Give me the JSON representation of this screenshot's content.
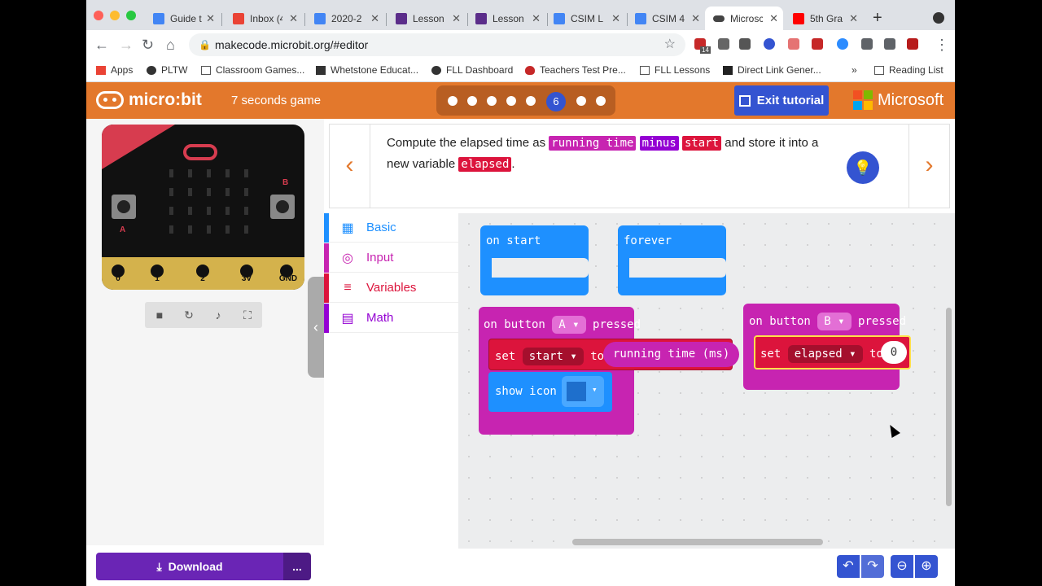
{
  "browser": {
    "tabs": [
      {
        "title": "Guide t",
        "color": "#4285f4"
      },
      {
        "title": "Inbox (4",
        "color": "#ea4335"
      },
      {
        "title": "2020-2",
        "color": "#4285f4"
      },
      {
        "title": "Lesson",
        "color": "#5b2d8a"
      },
      {
        "title": "Lesson",
        "color": "#5b2d8a"
      },
      {
        "title": "CSIM Li",
        "color": "#4285f4"
      },
      {
        "title": "CSIM 4",
        "color": "#4285f4"
      },
      {
        "title": "Microsc",
        "color": "#444444"
      },
      {
        "title": "5th Gra",
        "color": "#ff0000"
      }
    ],
    "new_tab": "+",
    "url": "makecode.microbit.org/#editor",
    "extension_badge": "14",
    "bookmarks": [
      {
        "label": "Apps"
      },
      {
        "label": "PLTW"
      },
      {
        "label": "Classroom Games..."
      },
      {
        "label": "Whetstone Educat..."
      },
      {
        "label": "FLL Dashboard"
      },
      {
        "label": "Teachers Test Pre..."
      },
      {
        "label": "FLL Lessons"
      },
      {
        "label": "Direct Link Gener..."
      }
    ],
    "bookmark_overflow": "»",
    "reading_list": "Reading List"
  },
  "header": {
    "logo_text": "micro:bit",
    "project_title": "7 seconds game",
    "current_step": "6",
    "exit_label": "Exit tutorial",
    "brand": "Microsoft",
    "brand_colors": [
      "#f25022",
      "#7fba00",
      "#00a4ef",
      "#ffb900"
    ],
    "accent": "#e3782c"
  },
  "simulator": {
    "button_a": "A",
    "button_b": "B",
    "pins": [
      "0",
      "1",
      "2",
      "3V",
      "GND"
    ]
  },
  "tutorial": {
    "text_1": "Compute the elapsed time as",
    "code_1": "running time",
    "code_2": "minus",
    "code_3": "start",
    "text_2": "and store it into a new variable",
    "code_4": "elapsed",
    "text_3": "."
  },
  "toolbox": {
    "categories": [
      {
        "label": "Basic",
        "color": "#1e90ff"
      },
      {
        "label": "Input",
        "color": "#c724b1"
      },
      {
        "label": "Variables",
        "color": "#dc143c"
      },
      {
        "label": "Math",
        "color": "#9400d3"
      }
    ]
  },
  "blocks": {
    "on_start": "on start",
    "forever": "forever",
    "on_button_a": {
      "prefix": "on button",
      "button": "A",
      "suffix": "pressed"
    },
    "set_start": {
      "set": "set",
      "variable": "start",
      "to": "to",
      "value": "running time (ms)"
    },
    "show_icon": "show icon",
    "on_button_b": {
      "prefix": "on button",
      "button": "B",
      "suffix": "pressed"
    },
    "set_elapsed": {
      "set": "set",
      "variable": "elapsed",
      "to": "to",
      "value": "0"
    }
  },
  "footer": {
    "download": "Download",
    "more": "..."
  }
}
